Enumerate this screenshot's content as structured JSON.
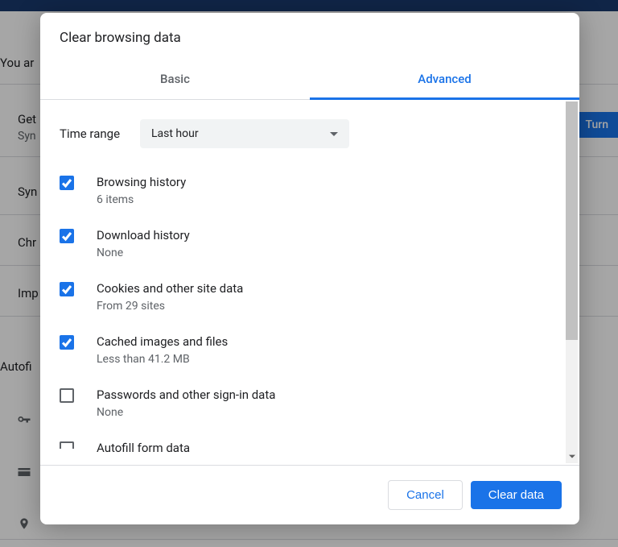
{
  "bg": {
    "you_are": "You ar",
    "rows": [
      {
        "title": "Get",
        "sub": "Syn"
      },
      {
        "title": "Syn",
        "sub": ""
      },
      {
        "title": "Chr",
        "sub": ""
      },
      {
        "title": "Imp",
        "sub": ""
      }
    ],
    "section": "Autofi",
    "button": "Turn"
  },
  "dialog": {
    "title": "Clear browsing data",
    "tabs": {
      "basic": "Basic",
      "advanced": "Advanced"
    },
    "time_range": {
      "label": "Time range",
      "value": "Last hour"
    },
    "items": [
      {
        "label": "Browsing history",
        "sub": "6 items",
        "checked": true
      },
      {
        "label": "Download history",
        "sub": "None",
        "checked": true
      },
      {
        "label": "Cookies and other site data",
        "sub": "From 29 sites",
        "checked": true
      },
      {
        "label": "Cached images and files",
        "sub": "Less than 41.2 MB",
        "checked": true
      },
      {
        "label": "Passwords and other sign-in data",
        "sub": "None",
        "checked": false
      },
      {
        "label": "Autofill form data",
        "sub": "",
        "checked": false
      }
    ],
    "buttons": {
      "cancel": "Cancel",
      "clear": "Clear data"
    }
  }
}
